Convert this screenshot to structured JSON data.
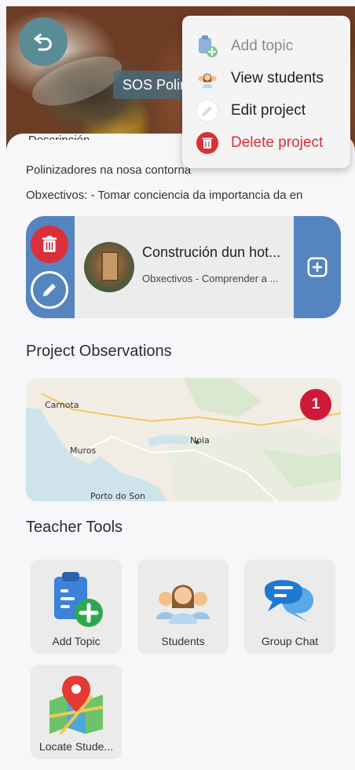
{
  "header": {
    "project_title": "SOS Polinizadores"
  },
  "project": {
    "subtitle": "Descripción",
    "description": "Polinizadores na nosa contorna",
    "objectives": "Obxectivos: - Tomar conciencia da importancia da en"
  },
  "topic": {
    "title": "Construción dun hot...",
    "subtitle": "Obxectivos - Comprender a ..."
  },
  "observations": {
    "section_title": "Project Observations",
    "map_labels": [
      "Carnota",
      "Muros",
      "Noia",
      "Porto do Son"
    ],
    "badge_count": "1"
  },
  "tools": {
    "section_title": "Teacher Tools",
    "items": [
      {
        "label": "Add Topic",
        "icon": "add-topic-icon"
      },
      {
        "label": "Students",
        "icon": "students-icon"
      },
      {
        "label": "Group Chat",
        "icon": "group-chat-icon"
      },
      {
        "label": "Locate Stude...",
        "icon": "locate-students-icon"
      }
    ]
  },
  "menu": {
    "items": [
      {
        "label": "Add topic",
        "icon": "add-topic-icon",
        "state": "disabled"
      },
      {
        "label": "View students",
        "icon": "students-icon"
      },
      {
        "label": "Edit project",
        "icon": "pencil-icon"
      },
      {
        "label": "Delete project",
        "icon": "trash-icon",
        "state": "danger"
      }
    ]
  },
  "colors": {
    "primary": "#5585c0",
    "danger": "#d9303a",
    "badge": "#d01838",
    "back_button": "#5b8c96"
  }
}
